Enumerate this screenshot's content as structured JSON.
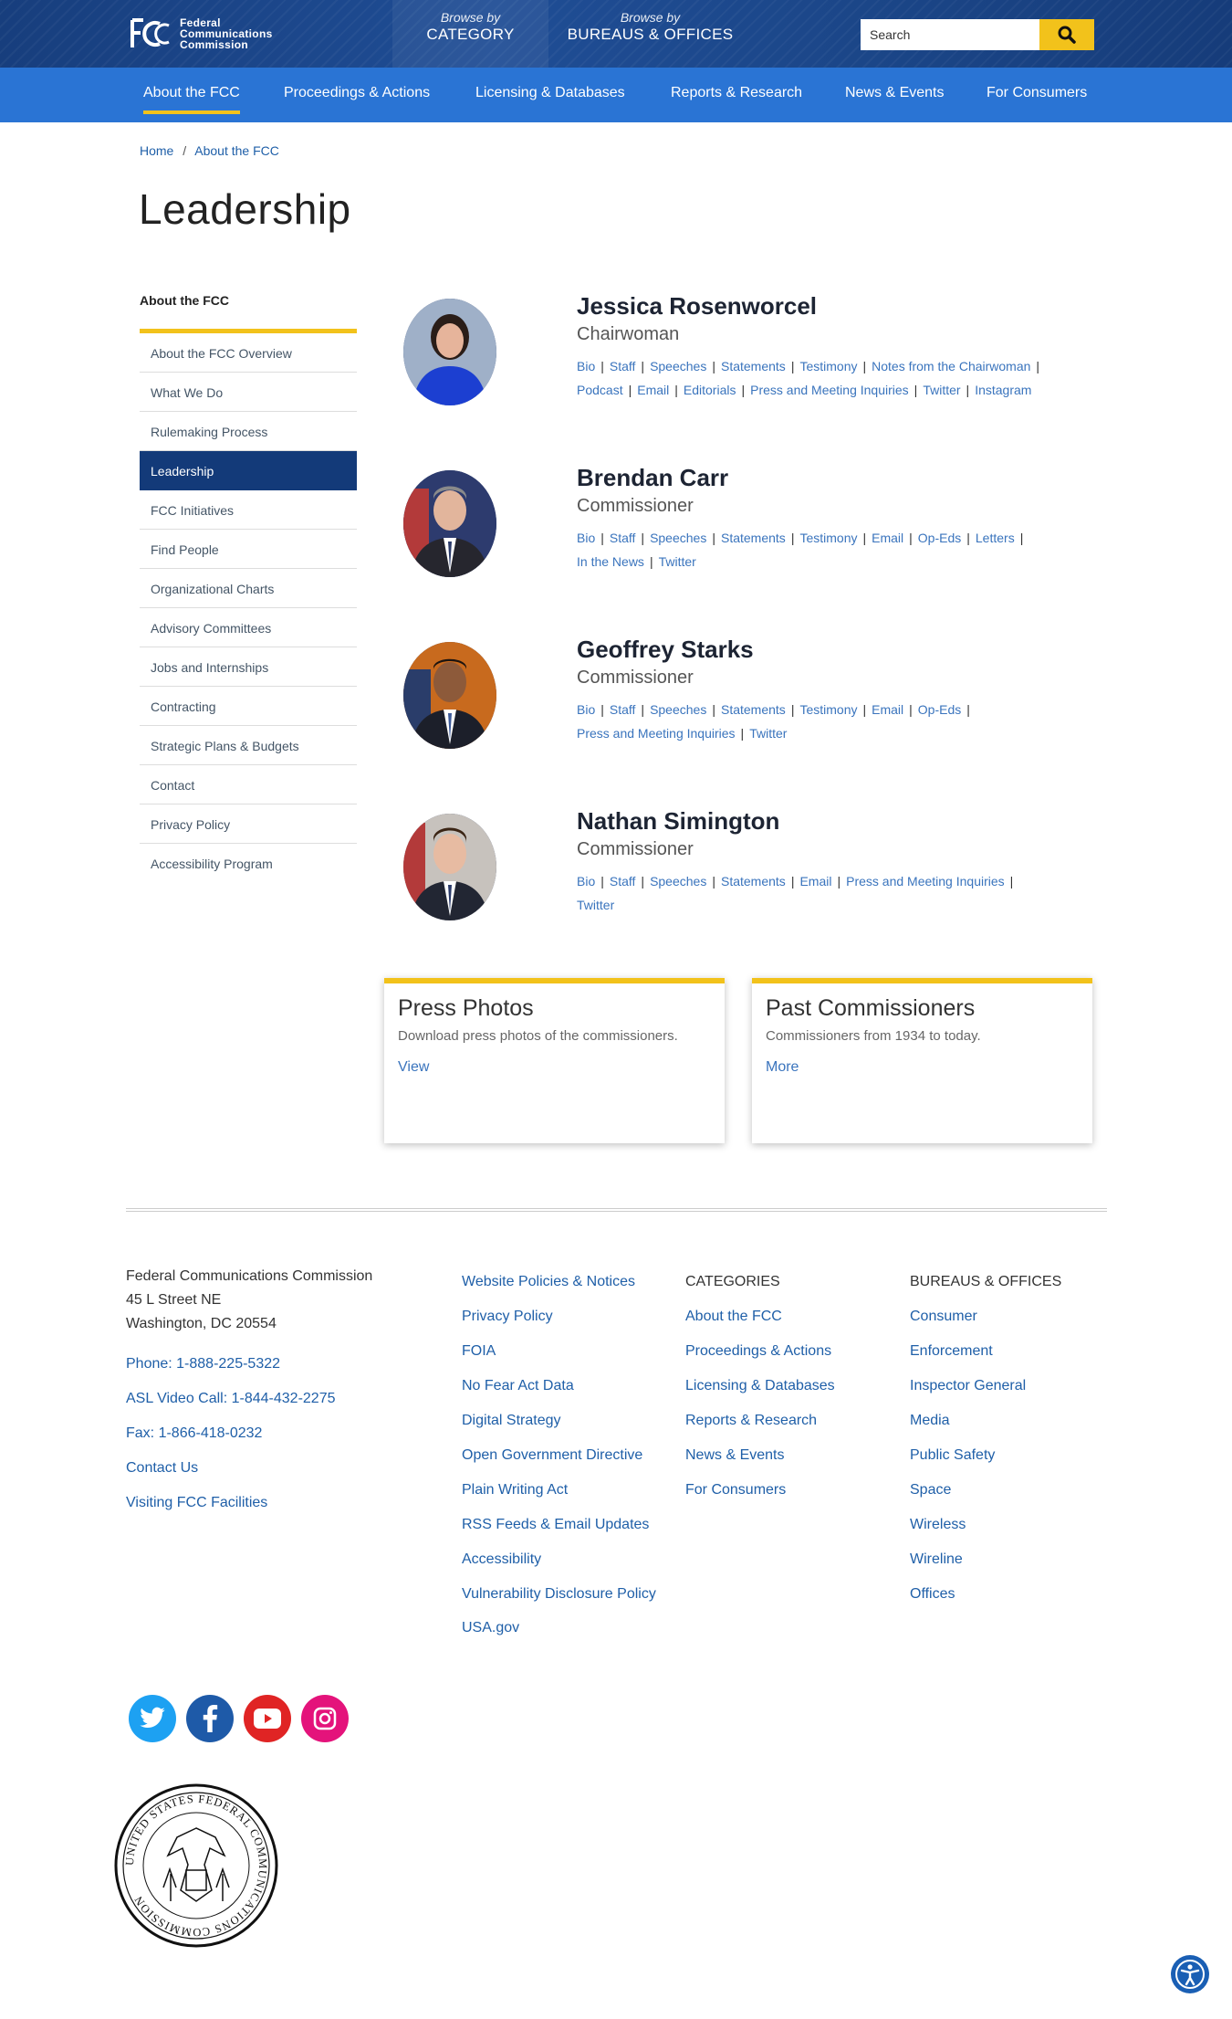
{
  "header": {
    "logo_lines": [
      "Federal",
      "Communications",
      "Commission"
    ],
    "browse_category": {
      "small": "Browse by",
      "large": "CATEGORY"
    },
    "browse_bureaus": {
      "small": "Browse by",
      "large": "BUREAUS & OFFICES"
    },
    "search_placeholder": "Search"
  },
  "nav": {
    "items": [
      "About the FCC",
      "Proceedings & Actions",
      "Licensing & Databases",
      "Reports & Research",
      "News & Events",
      "For Consumers"
    ],
    "active": "About the FCC"
  },
  "breadcrumb": {
    "home": "Home",
    "separator": "/",
    "current": "About the FCC"
  },
  "page_title": "Leadership",
  "sidebar": {
    "heading": "About the FCC",
    "items": [
      "About the FCC Overview",
      "What We Do",
      "Rulemaking Process",
      "Leadership",
      "FCC Initiatives",
      "Find People",
      "Organizational Charts",
      "Advisory Committees",
      "Jobs and Internships",
      "Contracting",
      "Strategic Plans & Budgets",
      "Contact",
      "Privacy Policy",
      "Accessibility Program"
    ],
    "active": "Leadership"
  },
  "leaders": [
    {
      "name": "Jessica Rosenworcel",
      "title": "Chairwoman",
      "links": [
        "Bio",
        "Staff",
        "Speeches",
        "Statements",
        "Testimony",
        "Notes from the Chairwoman",
        "Podcast",
        "Email",
        "Editorials",
        "Press and Meeting Inquiries",
        "Twitter",
        "Instagram"
      ]
    },
    {
      "name": "Brendan Carr",
      "title": "Commissioner",
      "links": [
        "Bio",
        "Staff",
        "Speeches",
        "Statements",
        "Testimony",
        "Email",
        "Op-Eds",
        "Letters",
        "In the News",
        "Twitter"
      ]
    },
    {
      "name": "Geoffrey Starks",
      "title": "Commissioner",
      "links": [
        "Bio",
        "Staff",
        "Speeches",
        "Statements",
        "Testimony",
        "Email",
        "Op-Eds",
        "Press and Meeting Inquiries",
        "Twitter"
      ]
    },
    {
      "name": "Nathan Simington",
      "title": "Commissioner",
      "links": [
        "Bio",
        "Staff",
        "Speeches",
        "Statements",
        "Email",
        "Press and Meeting Inquiries",
        "Twitter"
      ]
    }
  ],
  "cards": [
    {
      "title": "Press Photos",
      "desc": "Download press photos of the commissioners.",
      "link": "View"
    },
    {
      "title": "Past Commissioners",
      "desc": "Commissioners from 1934 to today.",
      "link": "More"
    }
  ],
  "footer": {
    "address": [
      "Federal Communications Commission",
      "45 L Street NE",
      "Washington, DC 20554"
    ],
    "contact_links": [
      "Phone: 1-888-225-5322",
      "ASL Video Call: 1-844-432-2275",
      "Fax: 1-866-418-0232",
      "Contact Us",
      "Visiting FCC Facilities"
    ],
    "policy_links": [
      "Website Policies & Notices",
      "Privacy Policy",
      "FOIA",
      "No Fear Act Data",
      "Digital Strategy",
      "Open Government Directive",
      "Plain Writing Act",
      "RSS Feeds & Email Updates",
      "Accessibility",
      "Vulnerability Disclosure Policy",
      "USA.gov"
    ],
    "categories_heading": "CATEGORIES",
    "categories": [
      "About the FCC",
      "Proceedings & Actions",
      "Licensing & Databases",
      "Reports & Research",
      "News & Events",
      "For Consumers"
    ],
    "bureaus_heading": "BUREAUS & OFFICES",
    "bureaus": [
      "Consumer",
      "Enforcement",
      "Inspector General",
      "Media",
      "Public Safety",
      "Space",
      "Wireless",
      "Wireline",
      "Offices"
    ],
    "social": [
      {
        "icon": "twitter-icon",
        "color": "#1da1f2"
      },
      {
        "icon": "facebook-icon",
        "color": "#1877f2"
      },
      {
        "icon": "youtube-icon",
        "color": "#e02424"
      },
      {
        "icon": "instagram-icon",
        "color": "#e4137b"
      }
    ],
    "seal_text": "UNITED STATES FEDERAL COMMUNICATIONS COMMISSION"
  },
  "colors": {
    "accent_yellow": "#f2c21b",
    "nav_blue": "#2a74d4",
    "header_blue": "#1b4688",
    "active_side": "#133a79"
  }
}
